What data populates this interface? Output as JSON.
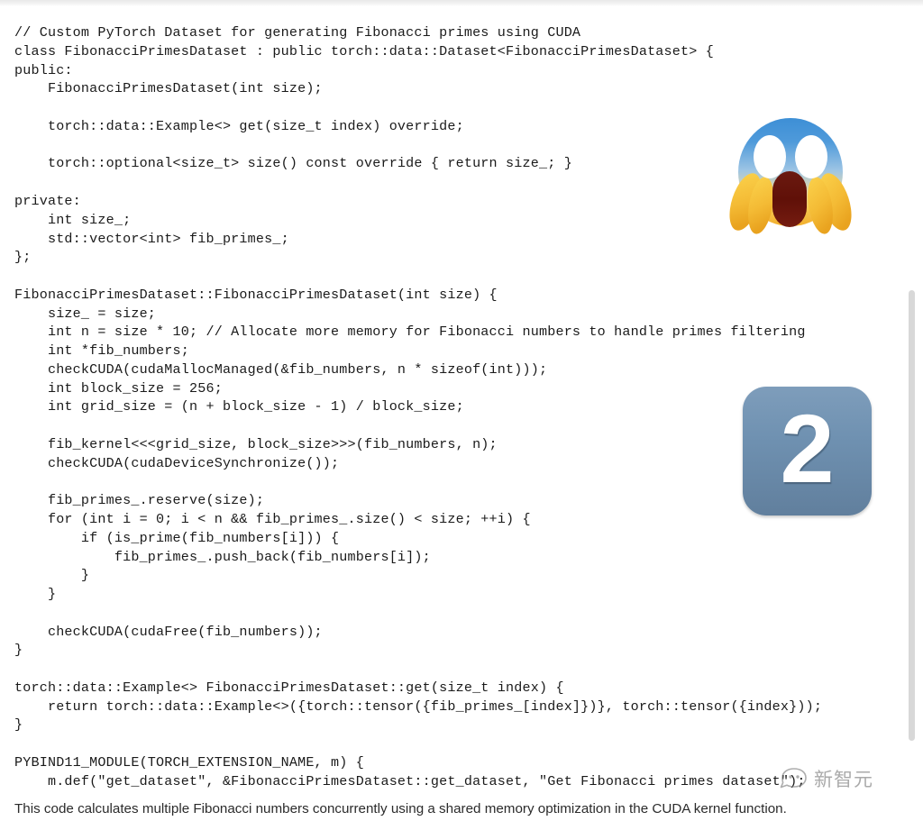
{
  "page": {
    "background_color": "#ffffff",
    "text_color": "#1a1a1a"
  },
  "code": {
    "language": "cpp",
    "lines": [
      "// Custom PyTorch Dataset for generating Fibonacci primes using CUDA",
      "class FibonacciPrimesDataset : public torch::data::Dataset<FibonacciPrimesDataset> {",
      "public:",
      "    FibonacciPrimesDataset(int size);",
      "",
      "    torch::data::Example<> get(size_t index) override;",
      "",
      "    torch::optional<size_t> size() const override { return size_; }",
      "",
      "private:",
      "    int size_;",
      "    std::vector<int> fib_primes_;",
      "};",
      "",
      "FibonacciPrimesDataset::FibonacciPrimesDataset(int size) {",
      "    size_ = size;",
      "    int n = size * 10; // Allocate more memory for Fibonacci numbers to handle primes filtering",
      "    int *fib_numbers;",
      "    checkCUDA(cudaMallocManaged(&fib_numbers, n * sizeof(int)));",
      "    int block_size = 256;",
      "    int grid_size = (n + block_size - 1) / block_size;",
      "",
      "    fib_kernel<<<grid_size, block_size>>>(fib_numbers, n);",
      "    checkCUDA(cudaDeviceSynchronize());",
      "",
      "    fib_primes_.reserve(size);",
      "    for (int i = 0; i < n && fib_primes_.size() < size; ++i) {",
      "        if (is_prime(fib_numbers[i])) {",
      "            fib_primes_.push_back(fib_numbers[i]);",
      "        }",
      "    }",
      "",
      "    checkCUDA(cudaFree(fib_numbers));",
      "}",
      "",
      "torch::data::Example<> FibonacciPrimesDataset::get(size_t index) {",
      "    return torch::data::Example<>({torch::tensor({fib_primes_[index]})}, torch::tensor({index}));",
      "}",
      "",
      "PYBIND11_MODULE(TORCH_EXTENSION_NAME, m) {",
      "    m.def(\"get_dataset\", &FibonacciPrimesDataset::get_dataset, \"Get Fibonacci primes dataset\");",
      "}"
    ]
  },
  "caption": {
    "text": "This code calculates multiple Fibonacci numbers concurrently using a shared memory optimization in the CUDA kernel function."
  },
  "decorations": {
    "emoji": {
      "name": "face-screaming-in-fear-emoji",
      "glyph": "😱",
      "description": "face screaming in fear"
    },
    "badge": {
      "name": "number-two-badge",
      "digit": "2",
      "background_color": "#6f91b1",
      "text_color": "#ffffff"
    }
  },
  "watermark": {
    "text": "新智元",
    "color": "#777777",
    "logo_icon": "speech-bubble-face-icon"
  },
  "scrollbar": {
    "orientation": "vertical",
    "thumb_color": "#d8d8d8"
  }
}
